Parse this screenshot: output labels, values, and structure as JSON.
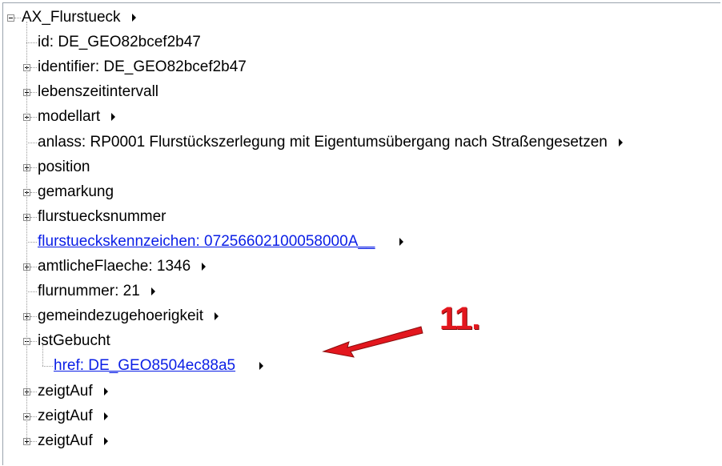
{
  "tree": {
    "root": {
      "label": "AX_Flurstueck",
      "has_menu": true
    },
    "children": [
      {
        "label": "id: DE_GEO82bcef2b47",
        "expander": "none",
        "link": false,
        "has_menu": false
      },
      {
        "label": "identifier: DE_GEO82bcef2b47",
        "expander": "plus",
        "link": false,
        "has_menu": false
      },
      {
        "label": "lebenszeitintervall",
        "expander": "plus",
        "link": false,
        "has_menu": false
      },
      {
        "label": "modellart",
        "expander": "plus",
        "link": false,
        "has_menu": true
      },
      {
        "label": "anlass: RP0001 Flurstückszerlegung mit Eigentumsübergang nach Straßengesetzen",
        "expander": "none",
        "link": false,
        "has_menu": true
      },
      {
        "label": "position",
        "expander": "plus",
        "link": false,
        "has_menu": false
      },
      {
        "label": "gemarkung",
        "expander": "plus",
        "link": false,
        "has_menu": false
      },
      {
        "label": "flurstuecksnummer",
        "expander": "plus",
        "link": false,
        "has_menu": false
      },
      {
        "label": "flurstueckskennzeichen: 07256602100058000A__",
        "expander": "none",
        "link": true,
        "has_menu": true
      },
      {
        "label": "amtlicheFlaeche: 1346",
        "expander": "plus",
        "link": false,
        "has_menu": true
      },
      {
        "label": "flurnummer: 21",
        "expander": "none",
        "link": false,
        "has_menu": true
      },
      {
        "label": "gemeindezugehoerigkeit",
        "expander": "plus",
        "link": false,
        "has_menu": true
      },
      {
        "label": "istGebucht",
        "expander": "minus",
        "link": false,
        "has_menu": false,
        "children": [
          {
            "label": "href: DE_GEO8504ec88a5",
            "link": true,
            "has_menu": true
          }
        ]
      },
      {
        "label": "zeigtAuf",
        "expander": "plus",
        "link": false,
        "has_menu": true
      },
      {
        "label": "zeigtAuf",
        "expander": "plus",
        "link": false,
        "has_menu": true
      },
      {
        "label": "zeigtAuf",
        "expander": "plus",
        "link": false,
        "has_menu": true
      }
    ]
  },
  "annotation": {
    "text": "11.",
    "color": "#e3171e"
  },
  "colors": {
    "link": "#0a1ee6",
    "annotation": "#e3171e",
    "border": "#9aa3ad"
  }
}
